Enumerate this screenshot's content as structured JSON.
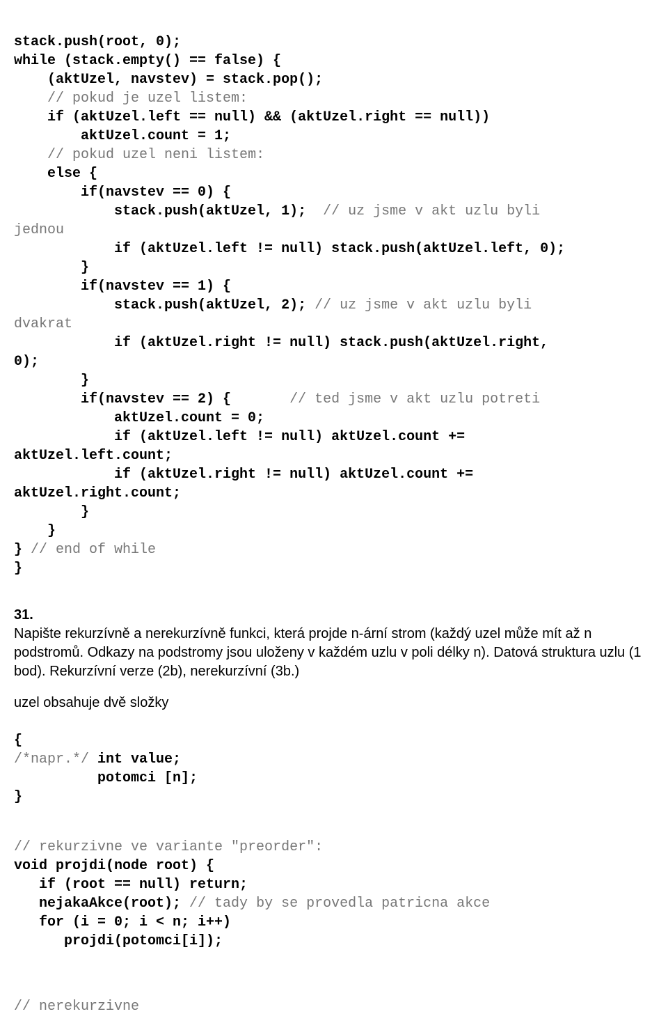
{
  "code1": {
    "l1": "stack.push(root, 0);",
    "l2": "while (stack.empty() == false) {",
    "l3": "    (aktUzel, navstev) = stack.pop();",
    "l4a": "    ",
    "l4c": "// pokud je uzel listem:",
    "l5": "    if (aktUzel.left == null) && (aktUzel.right == null))",
    "l6": "        aktUzel.count = 1;",
    "l7a": "    ",
    "l7c": "// pokud uzel neni listem:",
    "l8": "    else {",
    "l9": "        if(navstev == 0) {",
    "l10a": "            stack.push(aktUzel, 1);  ",
    "l10c": "// uz jsme v akt uzlu byli",
    "l11c": "jednou",
    "l12": "            if (aktUzel.left != null) stack.push(aktUzel.left, 0);",
    "l13": "        }",
    "l14": "        if(navstev == 1) {",
    "l15a": "            stack.push(aktUzel, 2); ",
    "l15c": "// uz jsme v akt uzlu byli",
    "l16c": "dvakrat",
    "l17": "            if (aktUzel.right != null) stack.push(aktUzel.right,",
    "l18": "0);",
    "l19": "        }",
    "l20a": "        if(navstev == 2) {       ",
    "l20c": "// ted jsme v akt uzlu potreti",
    "l21": "            aktUzel.count = 0;",
    "l22": "            if (aktUzel.left != null) aktUzel.count +=",
    "l23": "aktUzel.left.count;",
    "l24": "            if (aktUzel.right != null) aktUzel.count +=",
    "l25": "aktUzel.right.count;",
    "l26": "        }",
    "l27": "    }",
    "l28a": "} ",
    "l28c": "// end of while",
    "l29": "}"
  },
  "section_num": "31.",
  "prose1": "Napište rekurzívně a nerekurzívně funkci, která projde n-ární strom (každý uzel může mít až n podstromů. Odkazy na podstromy jsou uloženy v každém uzlu v poli délky n). Datová struktura uzlu (1 bod).  Rekurzívní verze (2b), nerekurzívní (3b.)",
  "prose2": "uzel obsahuje dvě složky",
  "code2": {
    "l1": "{",
    "l2a": "/*napr.*/",
    "l2b": " int value;",
    "l3": "          potomci [n];",
    "l4": "}"
  },
  "code3": {
    "l1c": "// rekurzivne ve variante \"preorder\":",
    "l2": "void projdi(node root) {",
    "l3": "   if (root == null) return;",
    "l4a": "   nejakaAkce(root);",
    "l4c": " // tady by se provedla patricna akce",
    "l5": "   for (i = 0; i < n; i++)",
    "l6": "      projdi(potomci[i]);"
  },
  "code4": {
    "l1c": "// nerekurzivne"
  }
}
